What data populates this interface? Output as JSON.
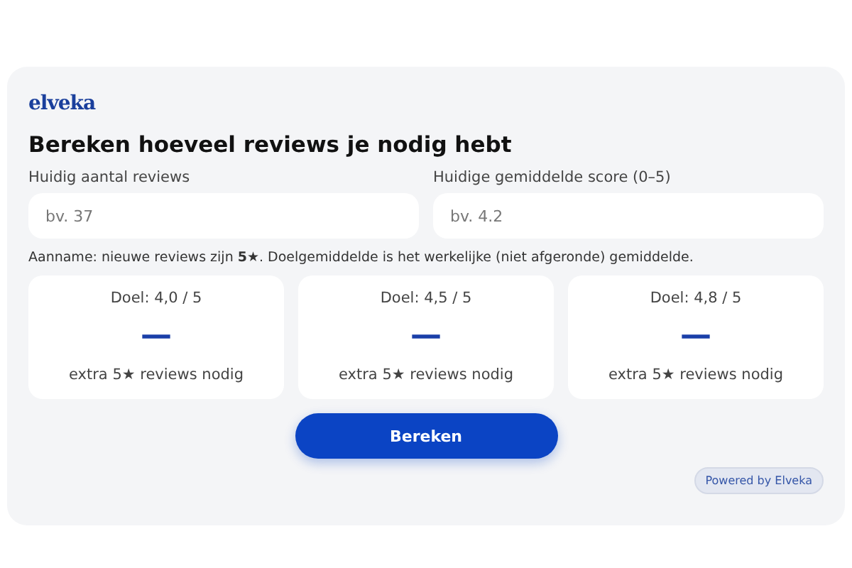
{
  "logo": "elveka",
  "title": "Bereken hoeveel reviews je nodig hebt",
  "fields": [
    {
      "label": "Huidig aantal reviews",
      "placeholder": "bv. 37"
    },
    {
      "label": "Huidige gemiddelde score (0–5)",
      "placeholder": "bv. 4.2"
    }
  ],
  "note": "Aanname: nieuwe reviews zijn **5★**. Doelgemiddelde is het werkelijke (niet afgeronde) gemiddelde.",
  "targets": [
    {
      "title": "Doel: 4,0 / 5",
      "result": "—",
      "caption": "extra 5★ reviews nodig"
    },
    {
      "title": "Doel: 4,5 / 5",
      "result": "—",
      "caption": "extra 5★ reviews nodig"
    },
    {
      "title": "Doel: 4,8 / 5",
      "result": "—",
      "caption": "extra 5★ reviews nodig"
    }
  ],
  "button": "Bereken",
  "powered_by": "Powered by Elveka"
}
